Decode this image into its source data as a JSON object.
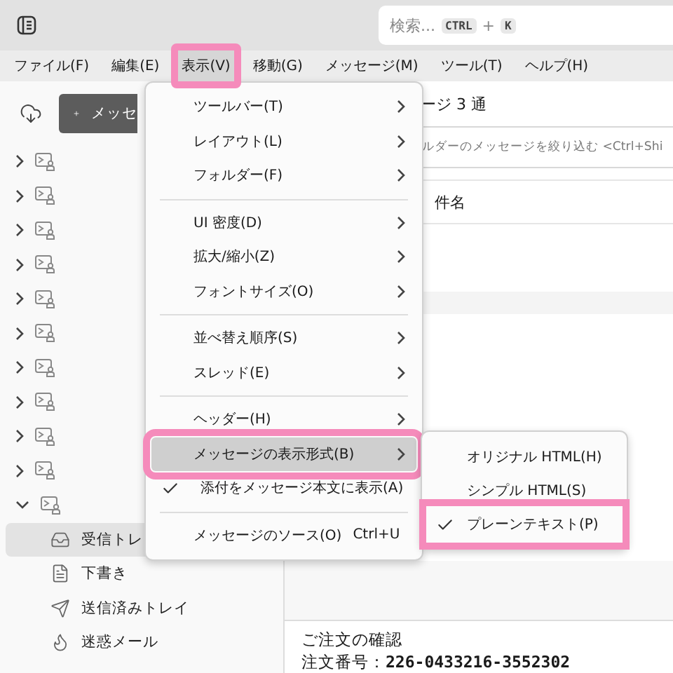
{
  "toolbar": {
    "search": {
      "placeholder": "検索...",
      "keys": [
        "CTRL",
        "K"
      ],
      "joiner": "+"
    }
  },
  "menubar": [
    {
      "label": "ファイル(F)",
      "selected": false,
      "highlighted": false
    },
    {
      "label": "編集(E)",
      "selected": false,
      "highlighted": false
    },
    {
      "label": "表示(V)",
      "selected": true,
      "highlighted": true
    },
    {
      "label": "移動(G)",
      "selected": false,
      "highlighted": false
    },
    {
      "label": "メッセージ(M)",
      "selected": false,
      "highlighted": false
    },
    {
      "label": "ツール(T)",
      "selected": false,
      "highlighted": false
    },
    {
      "label": "ヘルプ(H)",
      "selected": false,
      "highlighted": false
    }
  ],
  "sidebar": {
    "new_button": "メッセ",
    "accounts": [
      {
        "expanded": false
      },
      {
        "expanded": false
      },
      {
        "expanded": false
      },
      {
        "expanded": false
      },
      {
        "expanded": false
      },
      {
        "expanded": false
      },
      {
        "expanded": false
      },
      {
        "expanded": false
      },
      {
        "expanded": false
      },
      {
        "expanded": false
      },
      {
        "expanded": true,
        "folders": [
          {
            "kind": "inbox",
            "name": "受信トレ",
            "selected": true
          },
          {
            "kind": "drafts",
            "name": "下書き",
            "selected": false
          },
          {
            "kind": "sent",
            "name": "送信済みトレイ",
            "selected": false
          },
          {
            "kind": "junk",
            "name": "迷惑メール",
            "selected": false
          }
        ]
      }
    ]
  },
  "main": {
    "title": "ージ 3 通",
    "filter": {
      "placeholder": "ルダーのメッセージを絞り込む <Ctrl+Shi"
    },
    "column": "件名",
    "preview": {
      "subject": "ご注文の確認",
      "order": "注文番号：**226-0433216-3552302**"
    }
  },
  "view_menu": {
    "items": [
      {
        "kind": "submenu",
        "label": "ツールバー(T)"
      },
      {
        "kind": "submenu",
        "label": "レイアウト(L)"
      },
      {
        "kind": "submenu",
        "label": "フォルダー(F)"
      },
      {
        "kind": "separator"
      },
      {
        "kind": "submenu",
        "label": "UI 密度(D)"
      },
      {
        "kind": "submenu",
        "label": "拡大/縮小(Z)"
      },
      {
        "kind": "submenu",
        "label": "フォントサイズ(O)"
      },
      {
        "kind": "separator"
      },
      {
        "kind": "submenu",
        "label": "並べ替え順序(S)"
      },
      {
        "kind": "submenu",
        "label": "スレッド(E)"
      },
      {
        "kind": "separator"
      },
      {
        "kind": "submenu",
        "label": "ヘッダー(H)"
      },
      {
        "kind": "submenu",
        "label": "メッセージの表示形式(B)",
        "selected": true,
        "highlighted": true
      },
      {
        "kind": "check",
        "label": "添付をメッセージ本文に表示(A)",
        "checked": true
      },
      {
        "kind": "separator"
      },
      {
        "kind": "command",
        "label": "メッセージのソース(O)",
        "shortcut": "Ctrl+U"
      }
    ]
  },
  "format_submenu": {
    "items": [
      {
        "label": "オリジナル HTML(H)",
        "selected": false,
        "highlighted": false
      },
      {
        "label": "シンプル HTML(S)",
        "selected": false,
        "highlighted": false
      },
      {
        "label": "プレーンテキスト(P)",
        "selected": true,
        "highlighted": true
      }
    ]
  }
}
